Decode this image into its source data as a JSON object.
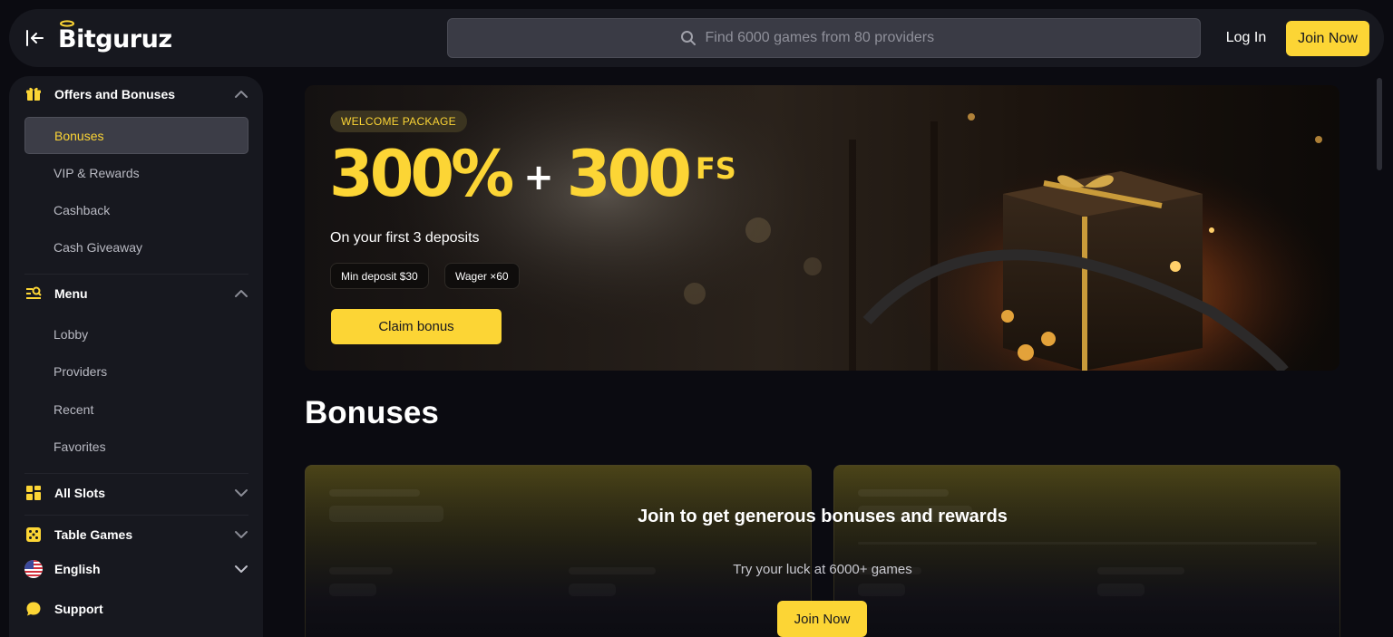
{
  "header": {
    "logo_text": "Bitguruz",
    "search_placeholder": "Find 6000 games from 80 providers",
    "login_label": "Log In",
    "join_label": "Join Now"
  },
  "sidebar": {
    "offers": {
      "label": "Offers and Bonuses",
      "items": [
        "Bonuses",
        "VIP & Rewards",
        "Cashback",
        "Cash Giveaway"
      ],
      "active": "Bonuses"
    },
    "menu": {
      "label": "Menu",
      "items": [
        "Lobby",
        "Providers",
        "Recent",
        "Favorites"
      ]
    },
    "all_slots": "All Slots",
    "table_games": "Table Games",
    "language": "English",
    "support": "Support"
  },
  "banner": {
    "tag": "WELCOME PACKAGE",
    "percent": "300%",
    "plus": "+",
    "spins": "300",
    "fs": "FS",
    "subtitle": "On your first 3 deposits",
    "chips": [
      "Min deposit $30",
      "Wager ×60"
    ],
    "claim_label": "Claim bonus"
  },
  "main": {
    "title": "Bonuses",
    "cta_title": "Join to get generous bonuses and rewards",
    "cta_sub": "Try your luck at 6000+ games",
    "cta_button": "Join Now"
  },
  "colors": {
    "accent": "#fcd535",
    "panel": "#17181f",
    "background": "#0b0b11"
  },
  "icons": {
    "collapse": "collapse-left-icon",
    "search": "search-icon",
    "gift": "gift-icon",
    "menu": "menu-search-icon",
    "slots": "grid-icon",
    "table": "dice-icon",
    "flag": "us-flag-icon",
    "support": "chat-bubble-icon"
  }
}
